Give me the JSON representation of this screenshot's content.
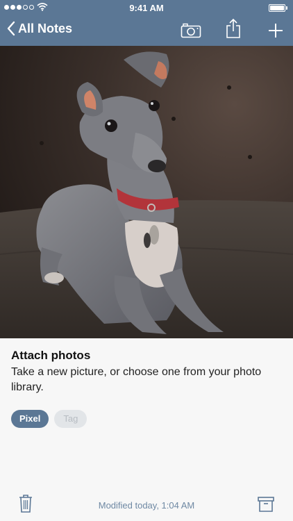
{
  "status_bar": {
    "time": "9:41 AM"
  },
  "nav": {
    "back_label": "All Notes",
    "icons": [
      "chevron-left-icon",
      "camera-icon",
      "share-icon",
      "plus-icon"
    ]
  },
  "note": {
    "title": "Attach photos",
    "body": "Take a new picture, or choose one from your photo library.",
    "photo": "italian-greyhound-puppy-photo"
  },
  "tags": [
    {
      "label": "Pixel",
      "selected": true
    },
    {
      "label": "Tag",
      "selected": false
    }
  ],
  "bottom_bar": {
    "modified": "Modified today, 1:04 AM",
    "icons": [
      "trash-icon",
      "archive-icon"
    ]
  },
  "colors": {
    "accent": "#5b7795",
    "background": "#f7f7f7",
    "muted_tag": "#e2e5e8",
    "footer_text": "#6e88a3"
  }
}
